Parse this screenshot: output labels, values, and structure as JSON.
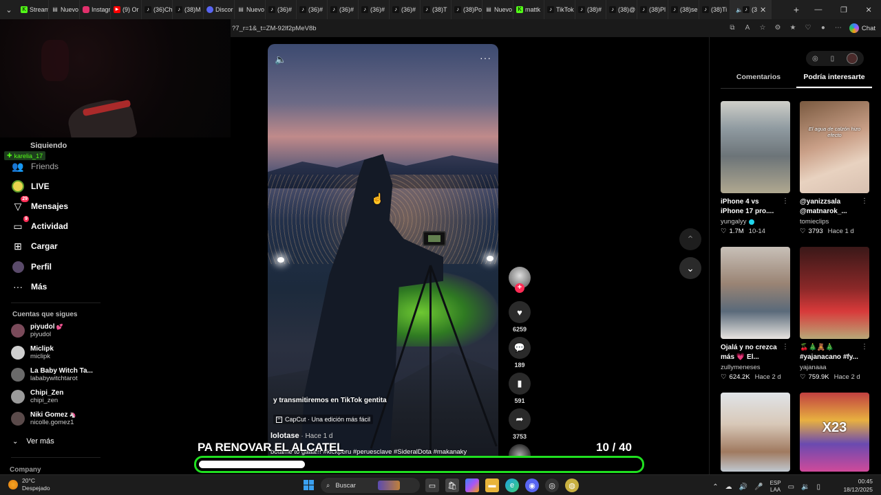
{
  "browser": {
    "tabs": [
      {
        "label": "Stream",
        "icon": "kick-icon",
        "color": "#53fc18"
      },
      {
        "label": "Nuevo",
        "icon": "page-icon",
        "color": "#888888"
      },
      {
        "label": "Instagr",
        "icon": "instagram-icon",
        "color": "#e1306c"
      },
      {
        "label": "(9) Or",
        "icon": "youtube-icon",
        "color": "#ff0000"
      },
      {
        "label": "(36)Ch",
        "icon": "tiktok-icon",
        "color": "#000000"
      },
      {
        "label": "(38)M",
        "icon": "tiktok-icon",
        "color": "#000000"
      },
      {
        "label": "Discor",
        "icon": "discord-icon",
        "color": "#5865f2"
      },
      {
        "label": "Nuevo",
        "icon": "page-icon",
        "color": "#888888"
      },
      {
        "label": "(36)#",
        "icon": "tiktok-icon",
        "color": "#000000"
      },
      {
        "label": "(36)#",
        "icon": "tiktok-icon",
        "color": "#000000"
      },
      {
        "label": "(36)#",
        "icon": "tiktok-icon",
        "color": "#000000"
      },
      {
        "label": "(36)#",
        "icon": "tiktok-icon",
        "color": "#000000"
      },
      {
        "label": "(36)#",
        "icon": "tiktok-icon",
        "color": "#000000"
      },
      {
        "label": "(38)T",
        "icon": "tiktok-icon",
        "color": "#000000"
      },
      {
        "label": "(38)Po",
        "icon": "tiktok-icon",
        "color": "#000000"
      },
      {
        "label": "Nuevo",
        "icon": "page-icon",
        "color": "#888888"
      },
      {
        "label": "mattk",
        "icon": "kick-icon",
        "color": "#53fc18"
      },
      {
        "label": "TikTok",
        "icon": "tiktok-icon",
        "color": "#000000"
      },
      {
        "label": "(38)#",
        "icon": "tiktok-icon",
        "color": "#000000"
      },
      {
        "label": "(38)@",
        "icon": "tiktok-icon",
        "color": "#000000"
      },
      {
        "label": "(38)Pl",
        "icon": "tiktok-icon",
        "color": "#000000"
      },
      {
        "label": "(38)se",
        "icon": "tiktok-icon",
        "color": "#000000"
      },
      {
        "label": "(38)Ti",
        "icon": "tiktok-icon",
        "color": "#000000"
      },
      {
        "label": "(3",
        "icon": "tiktok-icon",
        "color": "#000000"
      }
    ],
    "url": "?7_r=1&_t=ZM-92lf2pMeV8b",
    "chat_label": "Chat"
  },
  "kick_badge": "karelia_17",
  "leftnav": {
    "partial_label": "Siguiendo",
    "items": [
      {
        "label": "Friends",
        "icon": "friends-icon"
      },
      {
        "label": "LIVE",
        "icon": "live-icon"
      },
      {
        "label": "Mensajes",
        "icon": "messages-icon",
        "badge": "29"
      },
      {
        "label": "Actividad",
        "icon": "activity-icon",
        "badge": "9"
      },
      {
        "label": "Cargar",
        "icon": "upload-icon"
      },
      {
        "label": "Perfil",
        "icon": "profile-icon"
      },
      {
        "label": "Más",
        "icon": "more-icon"
      }
    ],
    "following_title": "Cuentas que sigues",
    "following": [
      {
        "name": "piyudol",
        "handle": "piyudol",
        "avatar_color": "#7a4a5a",
        "emoji": "💕"
      },
      {
        "name": "Miclipk",
        "handle": "miclipk",
        "avatar_color": "#cfcfcf",
        "emoji": ""
      },
      {
        "name": "La Baby Witch Ta...",
        "handle": "lababywitchtarot",
        "avatar_color": "#6a6a6a",
        "emoji": ""
      },
      {
        "name": "Chipi_Zen",
        "handle": "chipi_zen",
        "avatar_color": "#9a9a9a",
        "emoji": ""
      },
      {
        "name": "Niki Gomez",
        "handle": "nicolle.gomez1",
        "avatar_color": "#5a4a4a",
        "emoji": "🦄"
      }
    ],
    "see_more": "Ver más",
    "company": "Company"
  },
  "video": {
    "overlay_text": "y transmitiremos en TikTok gentita",
    "capcut": "CapCut · Una edición más fácil",
    "author": "lolotase",
    "time": " · Hace 1 d",
    "caption": "botame to gaaa!!! #kickperu #peruesclave #SideralDota #makanaky",
    "progress": 0.77
  },
  "actions": {
    "likes": "6259",
    "comments": "189",
    "saves": "591",
    "shares": "3753"
  },
  "stream": {
    "title": "PA RENOVAR EL ALCATEL",
    "counter": "10  / 40",
    "goal_progress": 0.25,
    "goal_color": "#20e020"
  },
  "rightpanel": {
    "tabs": [
      "Comentarios",
      "Podría interesarte"
    ],
    "active_tab": 1,
    "cards": [
      {
        "title": "iPhone 4 vs iPhone 17 pro....",
        "author": "yungalyy",
        "verified": true,
        "likes": "1.7M",
        "date": "10-14",
        "thumb": "subway",
        "thumb_text": ""
      },
      {
        "title": "@yanizzsala @matnarok_...",
        "author": "tomieclips",
        "verified": false,
        "likes": "3793",
        "date": "Hace 1 d",
        "thumb": "faces",
        "thumb_text": "El agua de calzón hizo efecto"
      },
      {
        "title": "Ojalá y no crezca más 💗 El...",
        "author": "zullymeneses",
        "verified": false,
        "likes": "624.2K",
        "date": "Hace 2 d",
        "thumb": "kids",
        "thumb_text": ""
      },
      {
        "title": "🍒🎄🧸🎄 #yajanacano #fy...",
        "author": "yajanaaa",
        "verified": false,
        "likes": "759.9K",
        "date": "Hace 2 d",
        "thumb": "santa",
        "thumb_text": ""
      },
      {
        "title": "",
        "author": "",
        "verified": false,
        "likes": "",
        "date": "",
        "thumb": "man",
        "thumb_text": ""
      },
      {
        "title": "",
        "author": "",
        "verified": false,
        "likes": "",
        "date": "",
        "thumb": "cartoon",
        "thumb_text": "X23"
      }
    ]
  },
  "taskbar": {
    "temp": "20°C",
    "weather": "Despejado",
    "search": "Buscar",
    "lang_top": "ESP",
    "lang_bottom": "LAA",
    "time": "00:45",
    "date": "18/12/2025"
  }
}
